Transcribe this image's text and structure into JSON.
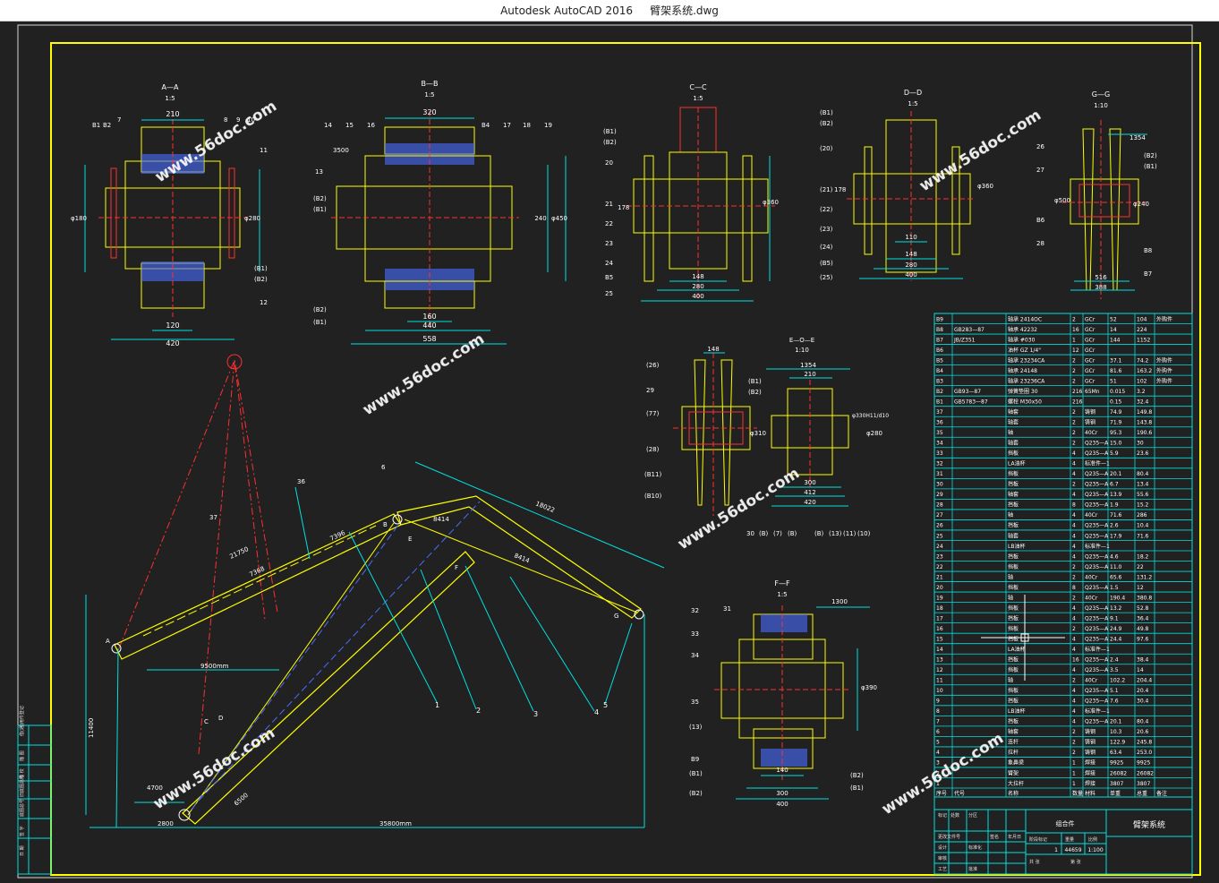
{
  "window": {
    "app_title": "Autodesk AutoCAD 2016",
    "file_name": "臂架系统.dwg"
  },
  "watermark": {
    "text": "www.56doc.com"
  },
  "colors": {
    "frame": "#ffff00",
    "cyan": "#00e0e0",
    "red": "#ff3030",
    "green": "#00ff00",
    "white": "#ffffff",
    "blue": "#4a6cff"
  },
  "views": {
    "aa": {
      "title": "A—A",
      "scale": "1:5",
      "dims": [
        "210",
        "120",
        "420",
        "φ180",
        "φ280"
      ],
      "labels": [
        "B1",
        "B2",
        "7",
        "8",
        "9",
        "10",
        "11",
        "12",
        "(B1)",
        "(B2)"
      ]
    },
    "bb": {
      "title": "B—B",
      "scale": "1:5",
      "dims": [
        "320",
        "3500",
        "160",
        "440",
        "558",
        "240",
        "φ450"
      ],
      "labels": [
        "14",
        "15",
        "16",
        "B4",
        "17",
        "18",
        "19",
        "13",
        "(B2)",
        "(B1)",
        "(B2)",
        "(B1)"
      ]
    },
    "cc": {
      "title": "C—C",
      "scale": "1:5",
      "dims": [
        "178",
        "148",
        "280",
        "400",
        "φ360"
      ],
      "labels": [
        "(B1)",
        "(B2)",
        "20",
        "21",
        "22",
        "23",
        "24",
        "B5",
        "25"
      ]
    },
    "dd": {
      "title": "D—D",
      "scale": "1:5",
      "dims": [
        "178",
        "110",
        "148",
        "280",
        "400",
        "φ360"
      ],
      "labels": [
        "(B1)",
        "(B2)",
        "(20)",
        "(21)",
        "(22)",
        "(23)",
        "(24)",
        "(B5)",
        "(25)"
      ]
    },
    "gg": {
      "title": "G—G",
      "scale": "1:10",
      "dims": [
        "1354",
        "φ500",
        "φ240",
        "516",
        "388"
      ],
      "labels": [
        "26",
        "27",
        "B6",
        "28",
        "(B2)",
        "(B1)",
        "B8",
        "B7"
      ]
    },
    "eoe": {
      "title": "E—O—E",
      "scale": "1:10",
      "dims": [
        "148",
        "1354",
        "210",
        "φ310",
        "φ330H11/d10",
        "φ280",
        "300",
        "412",
        "420"
      ],
      "labels": [
        "(26)",
        "29",
        "(77)",
        "(28)",
        "(B11)",
        "(B10)",
        "(B1)",
        "(B2)",
        "30",
        "(B)",
        "(7)",
        "(B)",
        "(B)",
        "(13)",
        "(11)",
        "(10)"
      ]
    },
    "ff": {
      "title": "F—F",
      "scale": "1:5",
      "dims": [
        "1300",
        "φ390",
        "140",
        "300",
        "400"
      ],
      "labels": [
        "32",
        "31",
        "33",
        "34",
        "35",
        "(13)",
        "B9",
        "(B1)",
        "(B2)",
        "(B2)",
        "(B1)"
      ]
    }
  },
  "main_view": {
    "dims": [
      "21750",
      "7368",
      "7396",
      "18022",
      "8414",
      "8414",
      "9500mm",
      "11400",
      "4700",
      "2800",
      "35800mm",
      "6500"
    ],
    "labels": [
      "36",
      "37",
      "6",
      "A",
      "B",
      "C",
      "D",
      "E",
      "G",
      "F",
      "1",
      "2",
      "3",
      "4",
      "5"
    ]
  },
  "bom": {
    "parts": [
      [
        "B9",
        "",
        "轴承 2414OC",
        "2",
        "GCr",
        "52",
        "104",
        "外购件"
      ],
      [
        "B8",
        "GB283—87",
        "轴承 42232",
        "16",
        "GCr",
        "14",
        "224",
        ""
      ],
      [
        "B7",
        "JB/Z351",
        "轴承 #030",
        "1",
        "GCr",
        "144",
        "1152",
        ""
      ],
      [
        "B6",
        "",
        "油杯 GZ 1/4\"",
        "12",
        "GCr",
        "",
        "",
        ""
      ],
      [
        "B5",
        "",
        "轴承 23234CA",
        "2",
        "GCr",
        "37.1",
        "74.2",
        "外购件"
      ],
      [
        "B4",
        "",
        "轴承 24148",
        "2",
        "GCr",
        "81.6",
        "163.2",
        "外购件"
      ],
      [
        "B3",
        "",
        "轴承 23236CA",
        "2",
        "GCr",
        "51",
        "102",
        "外购件"
      ],
      [
        "B2",
        "GB93—87",
        "弹簧垫圈 30",
        "216",
        "65Mn",
        "0.015",
        "3.2",
        ""
      ],
      [
        "B1",
        "GB5783—87",
        "螺栓 M30x50",
        "216",
        "",
        "0.15",
        "32.4",
        ""
      ],
      [
        "37",
        "",
        "轴套",
        "2",
        "铸钢",
        "74.9",
        "149.8",
        ""
      ],
      [
        "36",
        "",
        "轴套",
        "2",
        "铸钢",
        "71.9",
        "143.8",
        ""
      ],
      [
        "35",
        "",
        "轴",
        "2",
        "40Cr",
        "95.3",
        "190.6",
        ""
      ],
      [
        "34",
        "",
        "轴套",
        "2",
        "Q235—A",
        "15.0",
        "30",
        ""
      ],
      [
        "33",
        "",
        "挡板",
        "4",
        "Q235—A",
        "5.9",
        "23.6",
        ""
      ],
      [
        "32",
        "",
        "LA油杯",
        "4",
        "标准件—1",
        "",
        "",
        ""
      ],
      [
        "31",
        "",
        "挡板",
        "4",
        "Q235—A",
        "20.1",
        "80.4",
        ""
      ],
      [
        "30",
        "",
        "挡板",
        "2",
        "Q235—A",
        "6.7",
        "13.4",
        ""
      ],
      [
        "29",
        "",
        "轴套",
        "4",
        "Q235—A",
        "13.9",
        "55.6",
        ""
      ],
      [
        "28",
        "",
        "挡板",
        "8",
        "Q235—A",
        "1.9",
        "15.2",
        ""
      ],
      [
        "27",
        "",
        "轴",
        "4",
        "40Cr",
        "71.6",
        "286",
        ""
      ],
      [
        "26",
        "",
        "挡板",
        "4",
        "Q235—A",
        "2.6",
        "10.4",
        ""
      ],
      [
        "25",
        "",
        "轴套",
        "4",
        "Q235—A",
        "17.9",
        "71.6",
        ""
      ],
      [
        "24",
        "",
        "LB油杯",
        "4",
        "标准件—1",
        "",
        "",
        ""
      ],
      [
        "23",
        "",
        "挡板",
        "4",
        "Q235—A",
        "4.6",
        "18.2",
        ""
      ],
      [
        "22",
        "",
        "挡板",
        "2",
        "Q235—A",
        "11.0",
        "22",
        ""
      ],
      [
        "21",
        "",
        "轴",
        "2",
        "40Cr",
        "65.6",
        "131.2",
        ""
      ],
      [
        "20",
        "",
        "挡板",
        "8",
        "Q235—A",
        "1.5",
        "12",
        ""
      ],
      [
        "19",
        "",
        "轴",
        "2",
        "40Cr",
        "190.4",
        "380.8",
        ""
      ],
      [
        "18",
        "",
        "挡板",
        "4",
        "Q235—A",
        "13.2",
        "52.8",
        ""
      ],
      [
        "17",
        "",
        "挡板",
        "4",
        "Q235—A",
        "9.1",
        "36.4",
        ""
      ],
      [
        "16",
        "",
        "挡板",
        "2",
        "Q235—A",
        "24.9",
        "49.8",
        ""
      ],
      [
        "15",
        "",
        "挡板",
        "4",
        "Q235—A",
        "24.4",
        "97.6",
        ""
      ],
      [
        "14",
        "",
        "LA油杯",
        "4",
        "标准件—1",
        "",
        "",
        ""
      ],
      [
        "13",
        "",
        "挡板",
        "16",
        "Q235—A",
        "2.4",
        "38.4",
        ""
      ],
      [
        "12",
        "",
        "挡板",
        "4",
        "Q235—A",
        "3.5",
        "14",
        ""
      ],
      [
        "11",
        "",
        "轴",
        "2",
        "40Cr",
        "102.2",
        "204.4",
        ""
      ],
      [
        "10",
        "",
        "挡板",
        "4",
        "Q235—A",
        "5.1",
        "20.4",
        ""
      ],
      [
        "9",
        "",
        "挡板",
        "4",
        "Q235—A",
        "7.6",
        "30.4",
        ""
      ],
      [
        "8",
        "",
        "LB油杯",
        "4",
        "标准件—1",
        "",
        "",
        ""
      ],
      [
        "7",
        "",
        "挡板",
        "4",
        "Q235—A",
        "20.1",
        "80.4",
        ""
      ],
      [
        "6",
        "",
        "轴套",
        "2",
        "铸钢",
        "10.3",
        "20.6",
        ""
      ],
      [
        "5",
        "",
        "连杆",
        "2",
        "铸钢",
        "122.9",
        "245.8",
        ""
      ],
      [
        "4",
        "",
        "拉杆",
        "2",
        "铸钢",
        "63.4",
        "253.0",
        ""
      ],
      [
        "3",
        "",
        "象鼻梁",
        "1",
        "焊接",
        "9925",
        "9925",
        ""
      ],
      [
        "2",
        "",
        "臂架",
        "1",
        "焊接",
        "26082",
        "26082",
        ""
      ],
      [
        "1",
        "",
        "大拉杆",
        "1",
        "焊接",
        "3807",
        "3807",
        ""
      ]
    ],
    "header": [
      "序号",
      "代号",
      "名称",
      "数量",
      "材料",
      "单重",
      "总重",
      "备注"
    ],
    "title_block": {
      "drawing_name": "臂架系统",
      "assembly": "组合件",
      "weight": "44659",
      "scale": "1:100",
      "count": "1",
      "labels": [
        "标记",
        "处数",
        "分区",
        "更改文件号",
        "签名",
        "年月日",
        "设计",
        "标准化",
        "审核",
        "工艺",
        "批准",
        "阶段标记",
        "重量",
        "比例",
        "共 张",
        "第 张"
      ]
    }
  },
  "revision_column": {
    "labels": [
      "借(通)用件登记",
      "描 图",
      "描 校",
      "旧底图总号",
      "底图总号",
      "签 字",
      "日 期"
    ]
  }
}
